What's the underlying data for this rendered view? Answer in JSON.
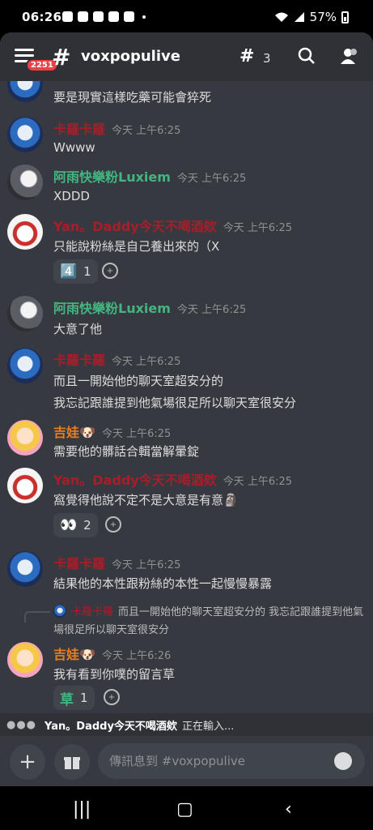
{
  "status_bar": {
    "time": "06:26",
    "battery": "57%"
  },
  "header": {
    "channel_name": "voxpopulive",
    "mention_count": "2251",
    "thread_count": "3"
  },
  "messages": [
    {
      "author": "",
      "time": "",
      "text": "要是現實這樣吃藥可能會猝死",
      "avatar": "blue"
    },
    {
      "author": "卡羅卡羅",
      "time": "今天 上午6:25",
      "text": "Wwww",
      "avatar": "blue"
    },
    {
      "author": "阿雨快樂粉Luxiem",
      "time": "今天 上午6:25",
      "text": "XDDD",
      "avatar": "gray"
    },
    {
      "author": "Yan。Daddy今天不喝酒欸",
      "time": "今天 上午6:25",
      "text": "只能說粉絲是自己養出來的（X",
      "avatar": "red",
      "reaction": {
        "emoji": "4️⃣",
        "count": "1"
      }
    },
    {
      "author": "阿雨快樂粉Luxiem",
      "time": "今天 上午6:25",
      "text": "大意了他",
      "avatar": "gray"
    },
    {
      "author": "卡羅卡羅",
      "time": "今天 上午6:25",
      "text": "而且一開始他的聊天室超安分的",
      "text2": "我忘記跟誰提到他氣場很足所以聊天室很安分",
      "avatar": "blue"
    },
    {
      "author": "吉娃🐶",
      "time": "今天 上午6:25",
      "text": "需要他的髒話合輯當解暈錠",
      "avatar": "pink"
    },
    {
      "author": "Yan。Daddy今天不喝酒欸",
      "time": "今天 上午6:25",
      "text": "窩覺得他說不定不是大意是有意🗿",
      "avatar": "red",
      "reaction": {
        "emoji": "👀",
        "count": "2"
      }
    },
    {
      "author": "卡羅卡羅",
      "time": "今天 上午6:25",
      "text": "結果他的本性跟粉絲的本性一起慢慢暴露",
      "avatar": "blue"
    },
    {
      "author": "吉娃🐶",
      "time": "今天 上午6:26",
      "text": "我有看到你噗的留言草",
      "avatar": "pink",
      "reply": {
        "author": "卡羅卡羅",
        "text": "而且一開始他的聊天室超安分的 我忘記跟誰提到他氣場很足所以聊天室很安分"
      },
      "reaction": {
        "emoji": "草",
        "count": "1"
      }
    }
  ],
  "typing": {
    "user": "Yan。Daddy今天不喝酒欸",
    "suffix": "正在輸入..."
  },
  "composer": {
    "placeholder": "傳訊息到 #voxpopulive"
  },
  "icons": [
    "menu-icon",
    "hash-icon",
    "threads-icon",
    "search-icon",
    "members-icon",
    "plus-icon",
    "gift-icon",
    "emoji-icon",
    "add-reaction-icon"
  ],
  "colors": {
    "background": "#36393f",
    "header": "#2f3136",
    "red_name": "#a91d2a",
    "green_name": "#43b581",
    "orange_name": "#e67e22"
  }
}
